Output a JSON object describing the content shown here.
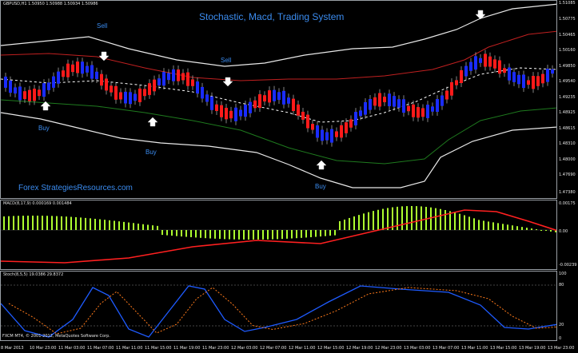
{
  "header": {
    "symbol_info": "GBPUSD,H1  1.50950 1.50988 1.50934 1.50986",
    "title": "Stochastic, Macd, Trading System"
  },
  "annotations": {
    "sell_1": "Sell",
    "sell_2": "Sell",
    "buy_1": "Buy",
    "buy_2": "Buy",
    "buy_3": "Buy",
    "watermark": "Forex StrategiesResources.com"
  },
  "price_axis": [
    "1.51085",
    "1.50775",
    "1.50465",
    "1.50160",
    "1.49850",
    "1.49540",
    "1.49235",
    "1.48925",
    "1.48615",
    "1.48310",
    "1.48000",
    "1.47690",
    "1.47380"
  ],
  "macd": {
    "label": "MACD(8,17,9) 0.000169 0.001484",
    "axis_top": "0.00175",
    "axis_zero": "0.00",
    "axis_bottom": "-0.00239"
  },
  "stoch": {
    "label": "Stoch(8,5,5) 19.0386 29.8372",
    "axis_top": "100",
    "level_80": "80",
    "level_20": "20",
    "axis_bottom": "0"
  },
  "footer": {
    "copyright": "FXCM MT4, © 2001-2012, MetaQuotes Software Corp."
  },
  "time_axis": [
    "8 Mar 2013",
    "10 Mar 23:00",
    "11 Mar 03:00",
    "11 Mar 07:00",
    "11 Mar 11:00",
    "11 Mar 15:00",
    "11 Mar 19:00",
    "11 Mar 23:00",
    "12 Mar 03:00",
    "12 Mar 07:00",
    "12 Mar 11:00",
    "12 Mar 15:00",
    "12 Mar 19:00",
    "12 Mar 23:00",
    "13 Mar 03:00",
    "13 Mar 07:00",
    "13 Mar 11:00",
    "13 Mar 15:00",
    "13 Mar 19:00",
    "13 Mar 23:00"
  ],
  "colors": {
    "background": "#000000",
    "bull_candle": "#1a2cff",
    "bear_candle": "#ff1a1a",
    "annotation_blue": "#3b8cf0",
    "macd_hist": "#adff2f",
    "macd_signal": "#ff2020",
    "stoch_main": "#1e5bff",
    "stoch_signal": "#ff7a1a"
  }
}
